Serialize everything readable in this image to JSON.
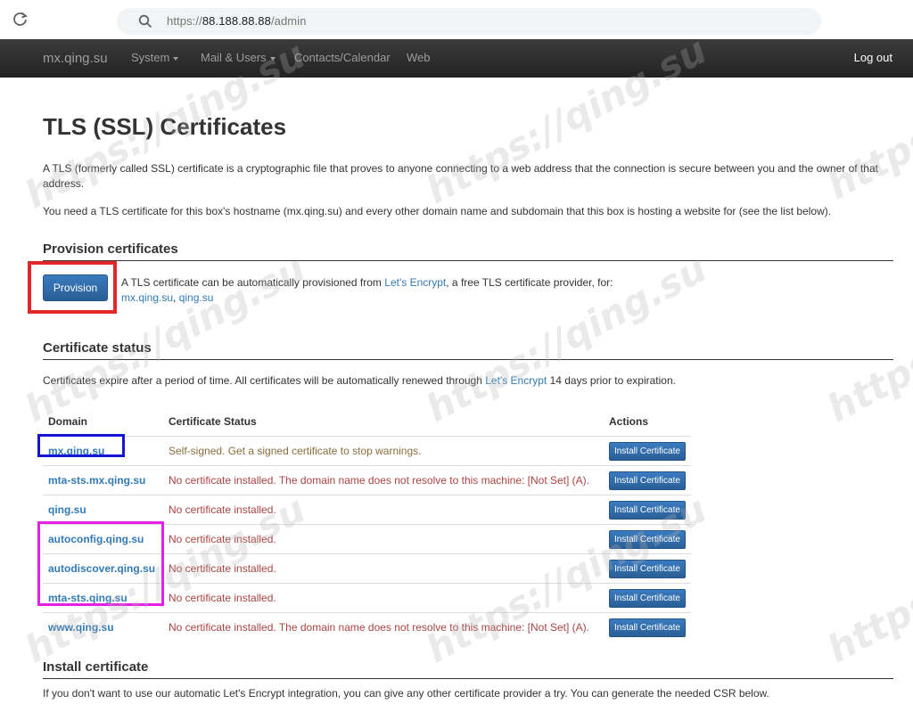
{
  "browser": {
    "url_prefix": "https://",
    "url_host": "88.188.88.88",
    "url_path": "/admin"
  },
  "navbar": {
    "brand": "mx.qing.su",
    "items": [
      {
        "label": "System",
        "has_caret": true
      },
      {
        "label": "Mail & Users",
        "has_caret": true
      },
      {
        "label": "Contacts/Calendar",
        "has_caret": false
      },
      {
        "label": "Web",
        "has_caret": false
      }
    ],
    "logout": "Log out"
  },
  "page": {
    "title": "TLS (SSL) Certificates",
    "intro": "A TLS (formerly called SSL) certificate is a cryptographic file that proves to anyone connecting to a web address that the connection is secure between you and the owner of that address.",
    "need": "You need a TLS certificate for this box's hostname (mx.qing.su) and every other domain name and subdomain that this box is hosting a website for (see the list below)."
  },
  "provision": {
    "heading": "Provision certificates",
    "button": "Provision",
    "text_before": "A TLS certificate can be automatically provisioned from ",
    "link": "Let's Encrypt",
    "text_after": ", a free TLS certificate provider, for:",
    "domains_a": "mx.qing.su",
    "domains_sep": ", ",
    "domains_b": "qing.su"
  },
  "status": {
    "heading": "Certificate status",
    "text_before": "Certificates expire after a period of time. All certificates will be automatically renewed through ",
    "link": "Let's Encrypt",
    "text_after": " 14 days prior to expiration.",
    "columns": [
      "Domain",
      "Certificate Status",
      "Actions"
    ],
    "install_label": "Install Certificate",
    "rows": [
      {
        "domain": "mx.qing.su",
        "status": "Self-signed. Get a signed certificate to stop warnings.",
        "level": "warn"
      },
      {
        "domain": "mta-sts.mx.qing.su",
        "status": "No certificate installed. The domain name does not resolve to this machine: [Not Set] (A).",
        "level": "err"
      },
      {
        "domain": "qing.su",
        "status": "No certificate installed.",
        "level": "err"
      },
      {
        "domain": "autoconfig.qing.su",
        "status": "No certificate installed.",
        "level": "err"
      },
      {
        "domain": "autodiscover.qing.su",
        "status": "No certificate installed.",
        "level": "err"
      },
      {
        "domain": "mta-sts.qing.su",
        "status": "No certificate installed.",
        "level": "err"
      },
      {
        "domain": "www.qing.su",
        "status": "No certificate installed. The domain name does not resolve to this machine: [Not Set] (A).",
        "level": "err"
      }
    ]
  },
  "install": {
    "heading": "Install certificate",
    "text": "If you don't want to use our automatic Let's Encrypt integration, you can give any other certificate provider a try. You can generate the needed CSR below."
  },
  "watermark": "https://qing.su",
  "colors": {
    "link": "#337ab7",
    "warn": "#8a6d3b",
    "error": "#a94442",
    "annotation_red": "#e32626",
    "annotation_blue": "#1515d6",
    "annotation_magenta": "#e61ee6"
  }
}
